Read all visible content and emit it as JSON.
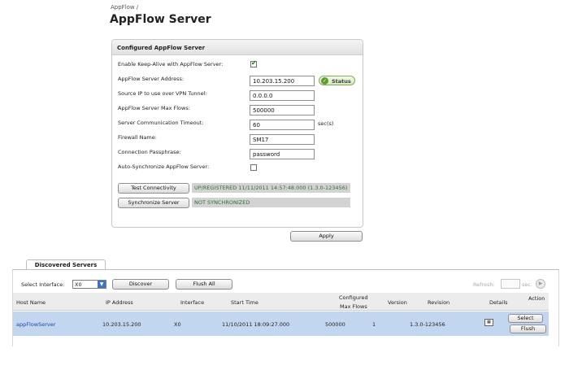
{
  "breadcrumb": "AppFlow /",
  "page_title": "AppFlow Server",
  "config": {
    "header": "Configured AppFlow Server",
    "keepalive": {
      "label": "Enable Keep-Alive with AppFlow Server:",
      "checked": true
    },
    "server_address": {
      "label": "AppFlow Server Address:",
      "value": "10.203.15.200"
    },
    "status_button": "Status",
    "source_ip": {
      "label": "Source IP to use over VPN Tunnel:",
      "value": "0.0.0.0"
    },
    "max_flows": {
      "label": "AppFlow Server Max Flows:",
      "value": "500000"
    },
    "timeout": {
      "label": "Server Communication Timeout:",
      "value": "60",
      "unit": "sec(s)"
    },
    "firewall_name": {
      "label": "Firewall Name:",
      "value": "SM17"
    },
    "passphrase": {
      "label": "Connection Passphrase:",
      "value": "password"
    },
    "auto_sync": {
      "label": "Auto-Synchronize AppFlow Server:",
      "checked": false
    },
    "test_button": "Test Connectivity",
    "test_result": "UP/REGISTERED 11/11/2011 14:57:48.000 (1.3.0-123456)",
    "sync_button": "Synchronize Server",
    "sync_result": "NOT SYNCHRONIZED"
  },
  "apply_button": "Apply",
  "discovered": {
    "tab_label": "Discovered Servers",
    "select_interface_label": "Select Interface:",
    "interface_value": "X0",
    "discover_button": "Discover",
    "flush_all_button": "Flush All",
    "refresh_label": "Refresh:",
    "refresh_unit": "sec.",
    "columns": {
      "host_name": "Host Name",
      "ip_address": "IP Address",
      "interface": "Interface",
      "start_time": "Start Time",
      "max_flows_1": "Configured",
      "max_flows_2": "Max Flows",
      "version": "Version",
      "revision": "Revision",
      "details": "Details",
      "action": "Action"
    },
    "rows": [
      {
        "host_name": "appFlowServer",
        "ip_address": "10.203.15.200",
        "interface": "X0",
        "start_time": "11/10/2011 18:09:27.000",
        "max_flows": "500000",
        "version": "1",
        "revision": "1.3.0-123456",
        "select_button": "Select",
        "flush_button": "Flush"
      }
    ]
  },
  "colors": {
    "row_highlight": "#c3d6ef",
    "status_green": "#5c9e2c",
    "link_blue": "#1d47a8",
    "result_bar": "#d3d3d3"
  }
}
